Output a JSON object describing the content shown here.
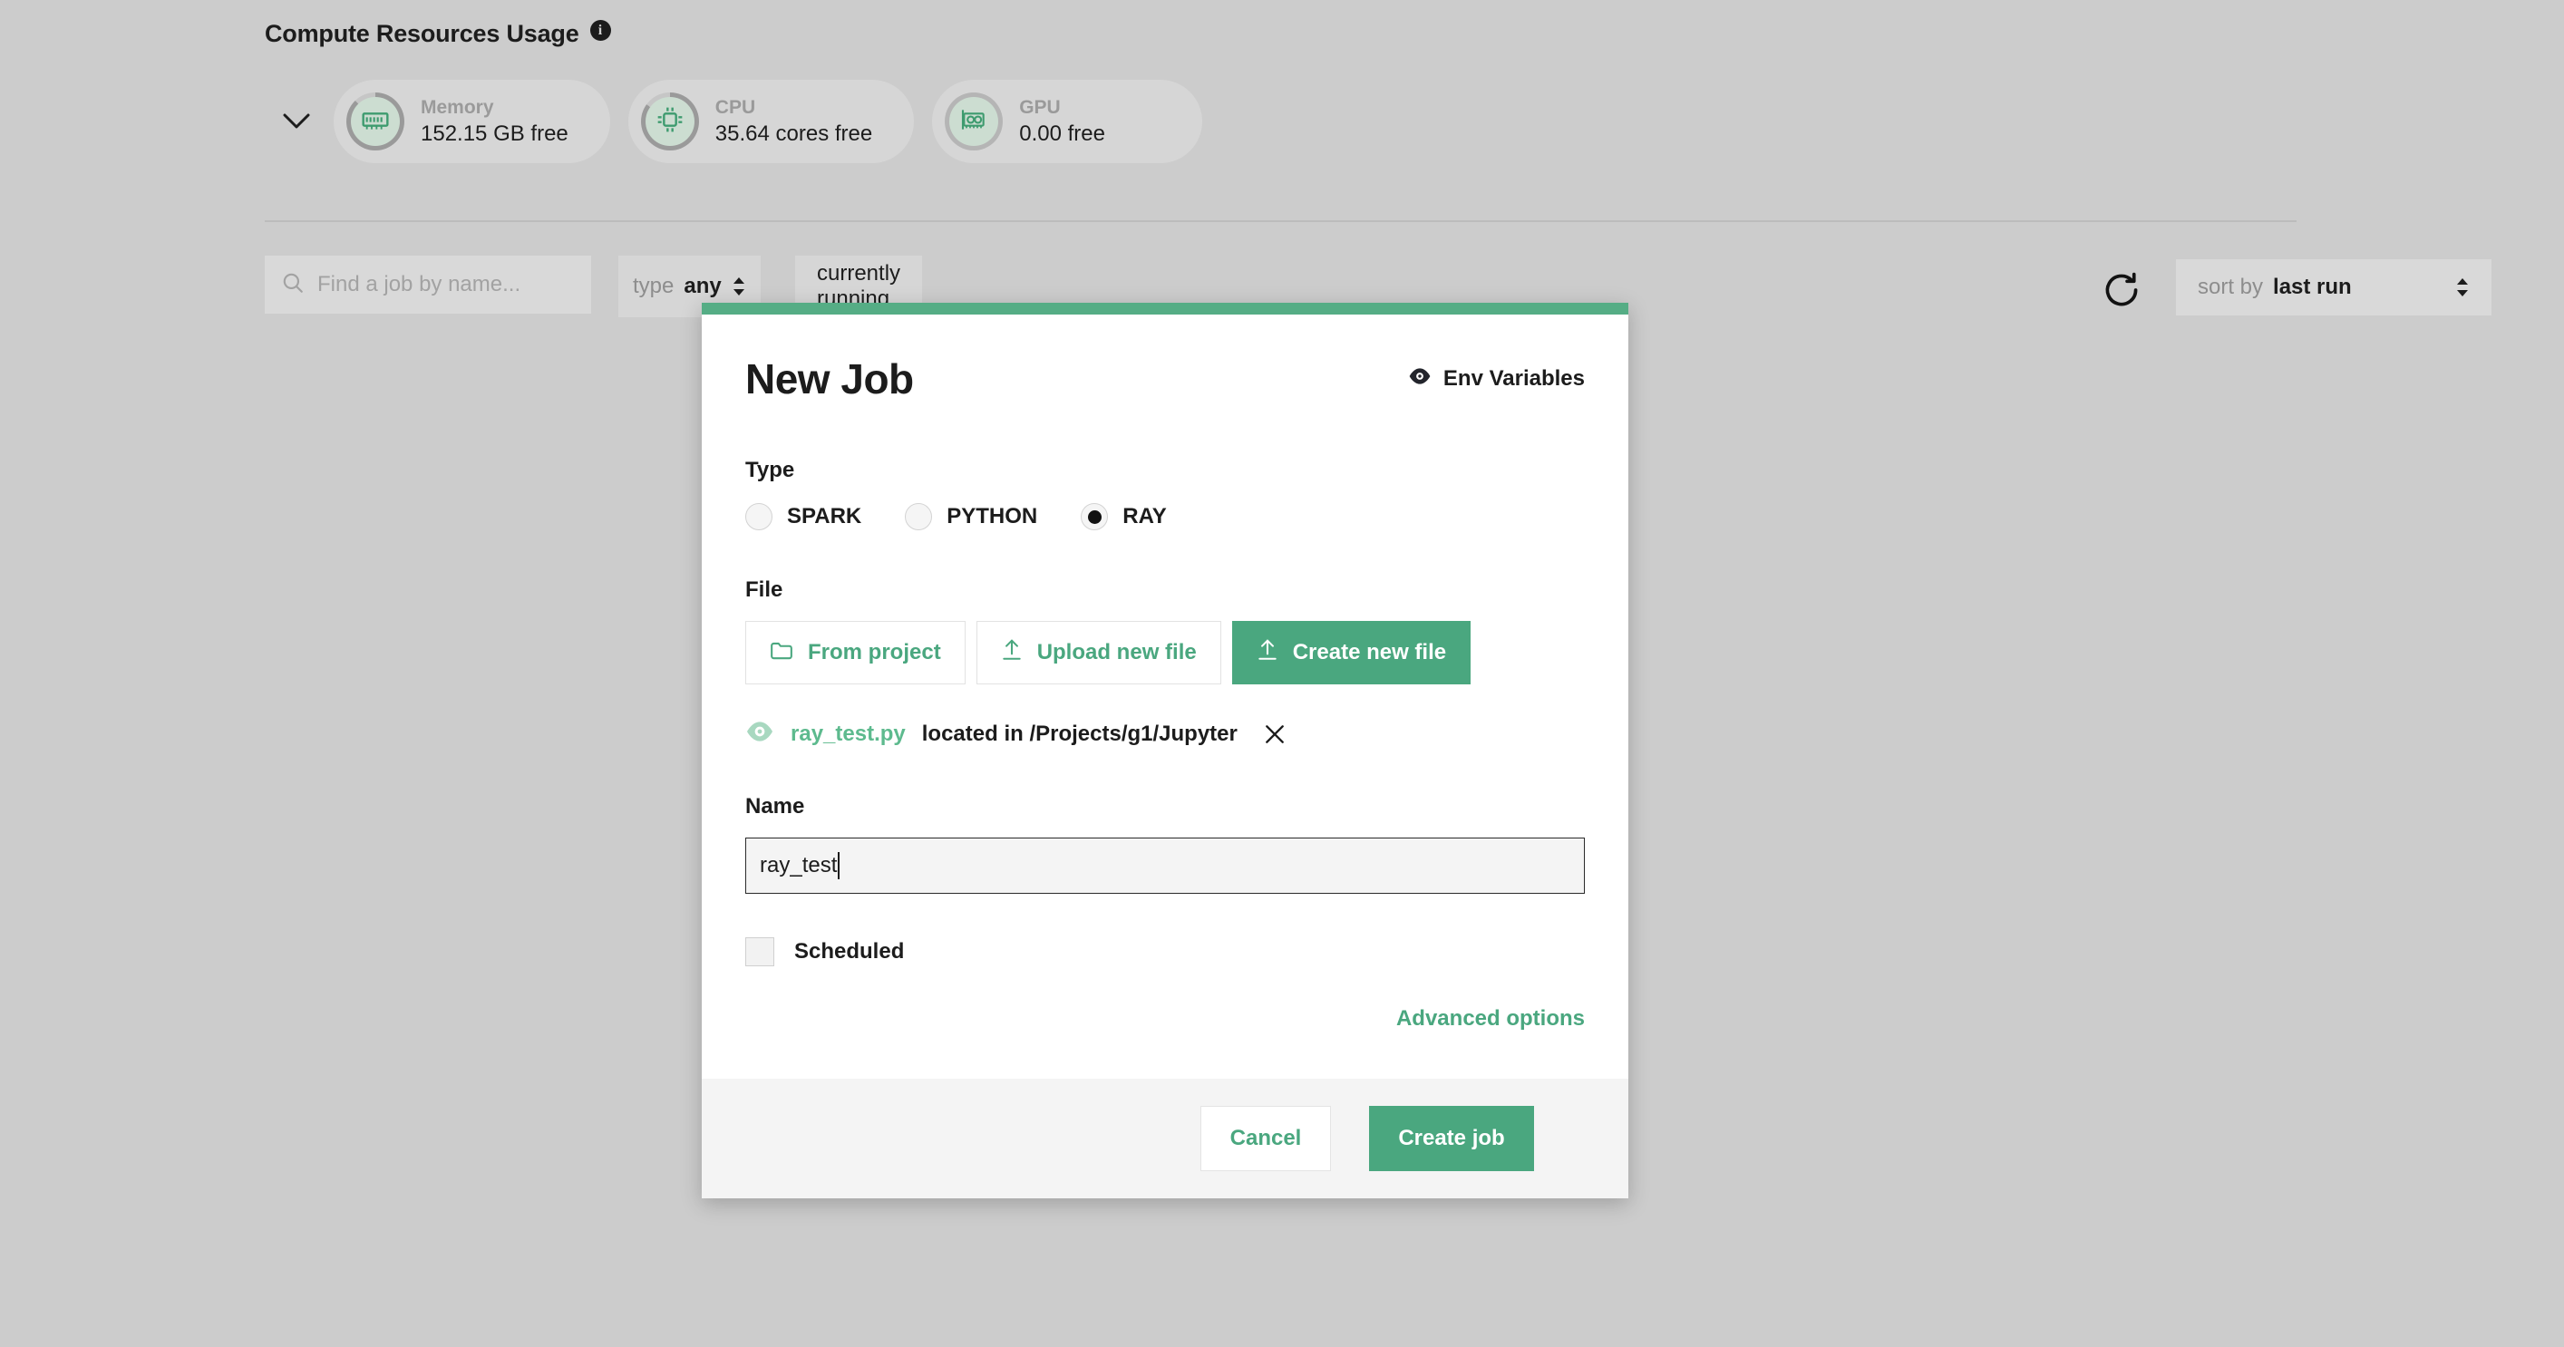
{
  "page": {
    "section_title": "Compute Resources Usage",
    "info_icon": "info-icon",
    "collapse_icon": "chevron-down-icon"
  },
  "resources": [
    {
      "icon": "memory-stick-icon",
      "label": "Memory",
      "value": "152.15 GB free",
      "ring_pct": 88
    },
    {
      "icon": "cpu-chip-icon",
      "label": "CPU",
      "value": "35.64 cores free",
      "ring_pct": 85
    },
    {
      "icon": "gpu-card-icon",
      "label": "GPU",
      "value": "0.00 free",
      "ring_pct": 100
    }
  ],
  "filters": {
    "search_placeholder": "Find a job by name...",
    "search_value": "",
    "search_icon": "search-icon",
    "type_label": "type",
    "type_value": "any",
    "status_chip": "currently running",
    "refresh_icon": "refresh-icon",
    "sort_label": "sort by",
    "sort_value": "last run"
  },
  "modal": {
    "title": "New Job",
    "env_variables_label": "Env Variables",
    "env_variables_icon": "eye-icon",
    "type": {
      "label": "Type",
      "options": [
        {
          "label": "SPARK",
          "checked": false
        },
        {
          "label": "PYTHON",
          "checked": false
        },
        {
          "label": "RAY",
          "checked": true
        }
      ]
    },
    "file": {
      "label": "File",
      "buttons": [
        {
          "label": "From project",
          "icon": "folder-icon",
          "primary": false
        },
        {
          "label": "Upload new file",
          "icon": "upload-icon",
          "primary": false
        },
        {
          "label": "Create new file",
          "icon": "upload-icon",
          "primary": true
        }
      ],
      "selected_icon": "eye-icon",
      "selected_name": "ray_test.py",
      "selected_path": "located in /Projects/g1/Jupyter",
      "remove_icon": "close-icon"
    },
    "name": {
      "label": "Name",
      "value": "ray_test",
      "placeholder": ""
    },
    "scheduled": {
      "label": "Scheduled",
      "checked": false
    },
    "advanced_options_label": "Advanced options",
    "footer": {
      "cancel_label": "Cancel",
      "create_label": "Create job"
    }
  },
  "colors": {
    "accent_green": "#4aa77f",
    "accent_bar": "#55ad85",
    "page_bg": "#cccccc",
    "footer_bg": "#f4f4f4"
  }
}
